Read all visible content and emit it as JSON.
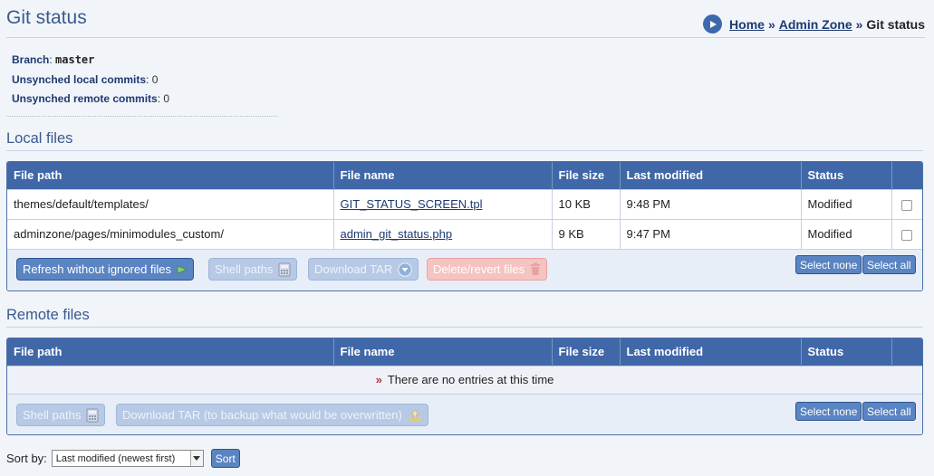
{
  "page": {
    "title": "Git status"
  },
  "breadcrumb": {
    "home": "Home",
    "sep1": "»",
    "admin": "Admin Zone",
    "sep2": "»",
    "current": "Git status"
  },
  "meta": {
    "branch_label": "Branch",
    "branch_value": "master",
    "local_label": "Unsynched local commits",
    "local_value": "0",
    "remote_label": "Unsynched remote commits",
    "remote_value": "0"
  },
  "local": {
    "title": "Local files",
    "columns": [
      "File path",
      "File name",
      "File size",
      "Last modified",
      "Status"
    ],
    "rows": [
      {
        "path": "themes/default/templates/",
        "name": "GIT_STATUS_SCREEN.tpl",
        "size": "10 KB",
        "modified": "9:48 PM",
        "status": "Modified"
      },
      {
        "path": "adminzone/pages/minimodules_custom/",
        "name": "admin_git_status.php",
        "size": "9 KB",
        "modified": "9:47 PM",
        "status": "Modified"
      }
    ],
    "buttons": {
      "refresh": "Refresh without ignored files",
      "shell": "Shell paths",
      "download": "Download TAR",
      "delete": "Delete/revert files",
      "select_none": "Select none",
      "select_all": "Select all"
    }
  },
  "remote": {
    "title": "Remote files",
    "columns": [
      "File path",
      "File name",
      "File size",
      "Last modified",
      "Status"
    ],
    "empty_marker": "»",
    "empty": "There are no entries at this time",
    "buttons": {
      "shell": "Shell paths",
      "download": "Download TAR (to backup what would be overwritten)",
      "select_none": "Select none",
      "select_all": "Select all"
    }
  },
  "sort": {
    "label": "Sort by:",
    "selected": "Last modified (newest first)",
    "button": "Sort"
  },
  "colors": {
    "header": "#4067a8",
    "accent": "#3a5a8e",
    "link": "#1d3a72"
  },
  "icons": {
    "breadcrumb": "play-circle-icon",
    "refresh": "play-arrow-icon",
    "shell": "calculator-icon",
    "download": "download-circle-icon",
    "delete": "trash-icon",
    "download_backup": "upload-tray-icon",
    "select": "dropdown-arrow-icon"
  }
}
